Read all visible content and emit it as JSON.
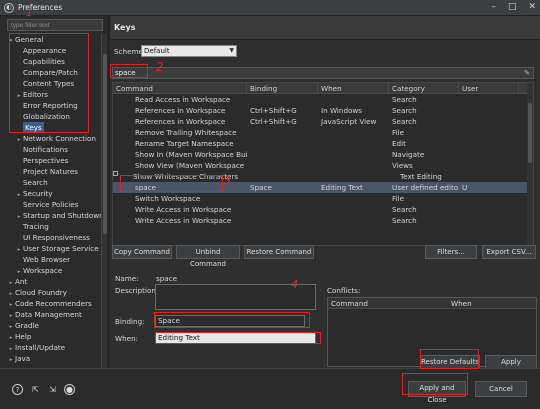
{
  "window": {
    "title": "Preferences",
    "controls": [
      "–",
      "□",
      "✕"
    ]
  },
  "filter": {
    "placeholder": "type filter text"
  },
  "tree": {
    "items": [
      {
        "label": "General",
        "indent": 0,
        "toggle": "▾"
      },
      {
        "label": "Appearance",
        "indent": 1,
        "toggle": ""
      },
      {
        "label": "Capabilities",
        "indent": 1,
        "toggle": ""
      },
      {
        "label": "Compare/Patch",
        "indent": 1,
        "toggle": ""
      },
      {
        "label": "Content Types",
        "indent": 1,
        "toggle": ""
      },
      {
        "label": "Editors",
        "indent": 1,
        "toggle": "▸"
      },
      {
        "label": "Error Reporting",
        "indent": 1,
        "toggle": ""
      },
      {
        "label": "Globalization",
        "indent": 1,
        "toggle": ""
      },
      {
        "label": "Keys",
        "indent": 1,
        "toggle": "",
        "selected": true
      },
      {
        "label": "Network Connection",
        "indent": 1,
        "toggle": "▸"
      },
      {
        "label": "Notifications",
        "indent": 1,
        "toggle": ""
      },
      {
        "label": "Perspectives",
        "indent": 1,
        "toggle": ""
      },
      {
        "label": "Project Natures",
        "indent": 1,
        "toggle": ""
      },
      {
        "label": "Search",
        "indent": 1,
        "toggle": ""
      },
      {
        "label": "Security",
        "indent": 1,
        "toggle": "▸"
      },
      {
        "label": "Service Policies",
        "indent": 1,
        "toggle": ""
      },
      {
        "label": "Startup and Shutdown",
        "indent": 1,
        "toggle": "▸"
      },
      {
        "label": "Tracing",
        "indent": 1,
        "toggle": ""
      },
      {
        "label": "UI Responsiveness",
        "indent": 1,
        "toggle": ""
      },
      {
        "label": "User Storage Service",
        "indent": 1,
        "toggle": "▸"
      },
      {
        "label": "Web Browser",
        "indent": 1,
        "toggle": ""
      },
      {
        "label": "Workspace",
        "indent": 1,
        "toggle": "▸"
      },
      {
        "label": "Ant",
        "indent": 0,
        "toggle": "▸"
      },
      {
        "label": "Cloud Foundry",
        "indent": 0,
        "toggle": "▸"
      },
      {
        "label": "Code Recommenders",
        "indent": 0,
        "toggle": "▸"
      },
      {
        "label": "Data Management",
        "indent": 0,
        "toggle": "▸"
      },
      {
        "label": "Gradle",
        "indent": 0,
        "toggle": "▸"
      },
      {
        "label": "Help",
        "indent": 0,
        "toggle": "▸"
      },
      {
        "label": "Install/Update",
        "indent": 0,
        "toggle": "▸"
      },
      {
        "label": "Java",
        "indent": 0,
        "toggle": "▸"
      }
    ]
  },
  "pane": {
    "title": "Keys"
  },
  "scheme": {
    "label": "Scheme:",
    "value": "Default"
  },
  "search": {
    "value": "space"
  },
  "table": {
    "columns": [
      "Command",
      "Binding",
      "When",
      "Category",
      "User"
    ],
    "rows": [
      {
        "command": "Read Access in Workspace",
        "binding": "",
        "when": "",
        "category": "Search",
        "user": ""
      },
      {
        "command": "References in Workspace",
        "binding": "Ctrl+Shift+G",
        "when": "In Windows",
        "category": "Search",
        "user": ""
      },
      {
        "command": "References in Workspace",
        "binding": "Ctrl+Shift+G",
        "when": "JavaScript View",
        "category": "Search",
        "user": ""
      },
      {
        "command": "Remove Trailing Whitespace",
        "binding": "",
        "when": "",
        "category": "File",
        "user": ""
      },
      {
        "command": "Rename Target Namespace",
        "binding": "",
        "when": "",
        "category": "Edit",
        "user": ""
      },
      {
        "command": "Show In (Maven Workspace Build)",
        "binding": "",
        "when": "",
        "category": "Navigate",
        "user": ""
      },
      {
        "command": "Show View (Maven Workspace Buil",
        "binding": "",
        "when": "",
        "category": "Views",
        "user": ""
      },
      {
        "command": "Show Whitespace Characters",
        "binding": "",
        "when": "",
        "category": "Text Editing",
        "user": "",
        "group": true
      },
      {
        "command": "space",
        "binding": "Space",
        "when": "Editing Text",
        "category": "User defined edito...",
        "user": "U",
        "highlight": true
      },
      {
        "command": "Switch Workspace",
        "binding": "",
        "when": "",
        "category": "File",
        "user": ""
      },
      {
        "command": "Write Access in Workspace",
        "binding": "",
        "when": "",
        "category": "Search",
        "user": ""
      },
      {
        "command": "Write Access in Workspace",
        "binding": "",
        "when": "",
        "category": "Search",
        "user": ""
      }
    ]
  },
  "buttons": {
    "copy": "Copy Command",
    "unbind": "Unbind Command",
    "restore_cmd": "Restore Command",
    "filters": "Filters...",
    "export": "Export CSV...",
    "restore_defaults": "Restore Defaults",
    "apply": "Apply",
    "apply_close": "Apply and Close",
    "cancel": "Cancel"
  },
  "details": {
    "name_label": "Name:",
    "name_value": "space",
    "description_label": "Description:",
    "binding_label": "Binding:",
    "binding_value": "Space",
    "when_label": "When:",
    "when_value": "Editing Text",
    "conflicts_label": "Conflicts:",
    "conflicts_columns": [
      "Command",
      "When"
    ]
  },
  "annotations": [
    "1",
    "2",
    "3",
    "4"
  ]
}
